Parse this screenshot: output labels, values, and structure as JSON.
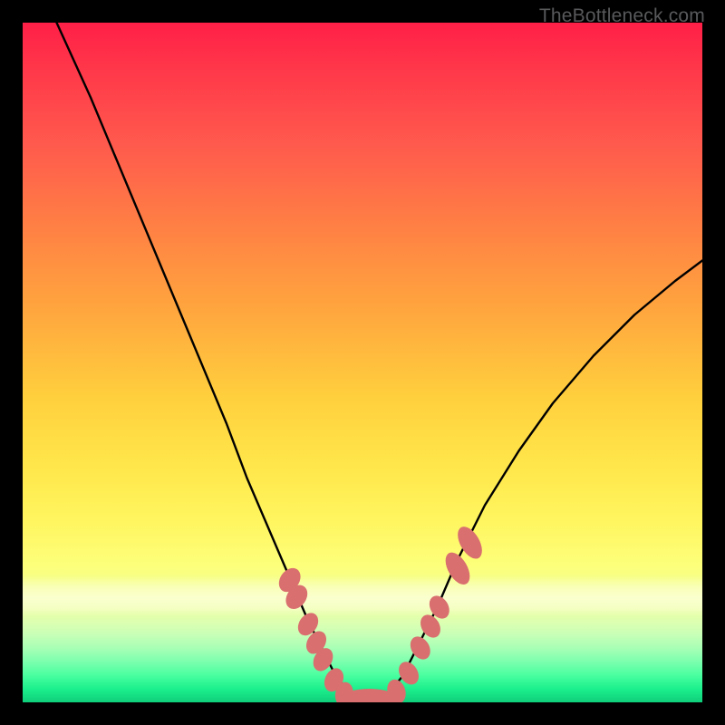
{
  "watermark": {
    "text": "TheBottleneck.com"
  },
  "chart_data": {
    "type": "line",
    "title": "",
    "xlabel": "",
    "ylabel": "",
    "xlim": [
      0,
      100
    ],
    "ylim": [
      0,
      100
    ],
    "grid": false,
    "legend": false,
    "series": [
      {
        "name": "bottleneck-curve",
        "color": "#000000",
        "x": [
          5,
          10,
          15,
          20,
          25,
          30,
          33,
          36,
          39,
          42,
          44,
          46,
          48,
          50,
          52,
          54,
          56,
          58,
          61,
          64,
          68,
          73,
          78,
          84,
          90,
          96,
          100
        ],
        "y": [
          100,
          89,
          77,
          65,
          53,
          41,
          33,
          26,
          19,
          12,
          8,
          4,
          1.5,
          0.5,
          0.5,
          1.5,
          4,
          8,
          14,
          21,
          29,
          37,
          44,
          51,
          57,
          62,
          65
        ]
      }
    ],
    "markers": [
      {
        "group": "left-lower",
        "color": "#d96f6f",
        "cx": 39.3,
        "cy": 18.0,
        "rx": 1.4,
        "ry": 1.9,
        "rot": 35
      },
      {
        "group": "left-lower",
        "color": "#d96f6f",
        "cx": 40.3,
        "cy": 15.5,
        "rx": 1.4,
        "ry": 1.9,
        "rot": 35
      },
      {
        "group": "left-lower",
        "color": "#d96f6f",
        "cx": 42.0,
        "cy": 11.5,
        "rx": 1.3,
        "ry": 1.8,
        "rot": 35
      },
      {
        "group": "left-lower",
        "color": "#d96f6f",
        "cx": 43.2,
        "cy": 8.8,
        "rx": 1.3,
        "ry": 1.8,
        "rot": 33
      },
      {
        "group": "left-lower",
        "color": "#d96f6f",
        "cx": 44.2,
        "cy": 6.3,
        "rx": 1.3,
        "ry": 1.8,
        "rot": 30
      },
      {
        "group": "left-lower",
        "color": "#d96f6f",
        "cx": 45.8,
        "cy": 3.3,
        "rx": 1.3,
        "ry": 1.8,
        "rot": 25
      },
      {
        "group": "bottom",
        "color": "#d96f6f",
        "cx": 47.3,
        "cy": 1.2,
        "rx": 1.3,
        "ry": 1.8,
        "rot": 10
      },
      {
        "group": "bottom-bar",
        "color": "#d96f6f",
        "cx": 51.0,
        "cy": 0.5,
        "rx": 4.2,
        "ry": 1.5,
        "rot": 0
      },
      {
        "group": "bottom",
        "color": "#d96f6f",
        "cx": 55.0,
        "cy": 1.6,
        "rx": 1.3,
        "ry": 1.8,
        "rot": -18
      },
      {
        "group": "right-lower",
        "color": "#d96f6f",
        "cx": 56.8,
        "cy": 4.3,
        "rx": 1.3,
        "ry": 1.8,
        "rot": -32
      },
      {
        "group": "right-lower",
        "color": "#d96f6f",
        "cx": 58.5,
        "cy": 8.0,
        "rx": 1.3,
        "ry": 1.8,
        "rot": -32
      },
      {
        "group": "right-lower",
        "color": "#d96f6f",
        "cx": 60.0,
        "cy": 11.2,
        "rx": 1.3,
        "ry": 1.8,
        "rot": -32
      },
      {
        "group": "right-lower",
        "color": "#d96f6f",
        "cx": 61.3,
        "cy": 14.0,
        "rx": 1.3,
        "ry": 1.8,
        "rot": -32
      },
      {
        "group": "right-upper",
        "color": "#d96f6f",
        "cx": 64.0,
        "cy": 19.7,
        "rx": 1.4,
        "ry": 2.6,
        "rot": -30
      },
      {
        "group": "right-upper",
        "color": "#d96f6f",
        "cx": 65.8,
        "cy": 23.5,
        "rx": 1.4,
        "ry": 2.6,
        "rot": -30
      }
    ],
    "background_gradient": {
      "type": "vertical",
      "stops": [
        {
          "pos": 0,
          "color": "#ff1f47"
        },
        {
          "pos": 50,
          "color": "#ffcf3d"
        },
        {
          "pos": 85,
          "color": "#f7ff9a"
        },
        {
          "pos": 100,
          "color": "#0fce7a"
        }
      ]
    }
  }
}
